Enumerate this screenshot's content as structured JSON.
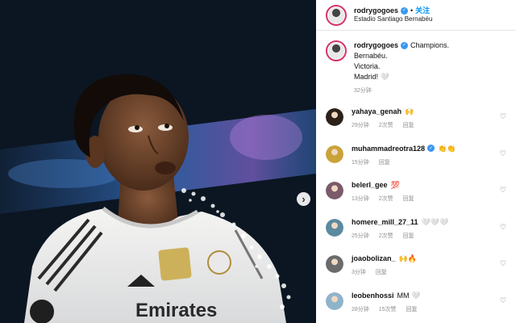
{
  "header": {
    "username": "rodrygogoes",
    "separator": "•",
    "follow_label": "关注",
    "location": "Estadio Santiago Bernabéu"
  },
  "caption": {
    "username": "rodrygogoes",
    "lines": [
      "Champions.",
      "Bernabéu.",
      "Victoria.",
      "Madrid! 🤍"
    ],
    "time": "32分钟"
  },
  "photo": {
    "sponsor_text": "Emirates"
  },
  "comments": [
    {
      "username": "yahaya_genah",
      "text": "🙌",
      "time": "29分钟",
      "likes": "2次赞",
      "reply": "回复",
      "avatar_color": "#2b2118",
      "verified": false
    },
    {
      "username": "muhammadreotra128",
      "text": "👏👏",
      "time": "15分钟",
      "likes": "",
      "reply": "回复",
      "avatar_color": "#c9a23a",
      "verified": true
    },
    {
      "username": "belerl_gee",
      "text": "💯",
      "time": "13分钟",
      "likes": "2次赞",
      "reply": "回复",
      "avatar_color": "#7a5a6b",
      "verified": false
    },
    {
      "username": "homere_mill_27_11",
      "text": "🤍🤍🤍",
      "time": "25分钟",
      "likes": "2次赞",
      "reply": "回复",
      "avatar_color": "#5c8a9e",
      "verified": false
    },
    {
      "username": "joaobolizan_",
      "text": "🙌🔥",
      "time": "3分钟",
      "likes": "",
      "reply": "回复",
      "avatar_color": "#6b6b6b",
      "verified": false
    },
    {
      "username": "leobenhossi",
      "text": "MM 🤍",
      "time": "28分钟",
      "likes": "15次赞",
      "reply": "回复",
      "avatar_color": "#8fb3c9",
      "verified": false
    }
  ],
  "colors": {
    "verified": "#3897f0",
    "follow": "#0095f6",
    "story_ring": "#d6336c",
    "meta_gray": "#8e8e8e"
  },
  "icons": {
    "verified": "verified-badge-icon",
    "next": "chevron-right-icon",
    "like": "heart-outline-icon"
  }
}
